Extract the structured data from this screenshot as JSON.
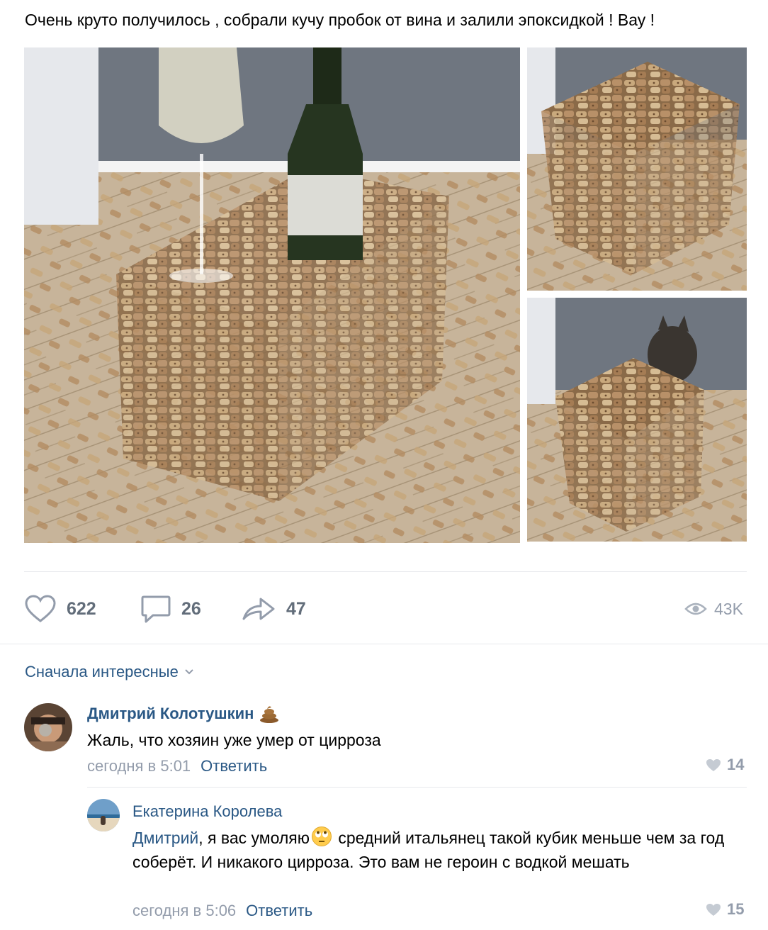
{
  "post": {
    "text": "Очень круто получилось , собрали кучу пробок от вина и залили эпоксидкой ! Вау !",
    "images": [
      {
        "description": "cork-cube-with-wine-bottle-and-glass"
      },
      {
        "description": "cork-cube-top-view"
      },
      {
        "description": "cork-cube-with-cat"
      }
    ]
  },
  "actions": {
    "likes": "622",
    "comments": "26",
    "shares": "47",
    "views": "43K"
  },
  "comments_sort": "Сначала интересные",
  "comments": [
    {
      "author": "Дмитрий Колотушкин",
      "author_emoji": "poop-emoji",
      "text": "Жаль, что хозяин уже умер от цирроза",
      "time": "сегодня в 5:01",
      "reply_label": "Ответить",
      "likes": "14"
    },
    {
      "author": "Екатерина Королева",
      "mention": "Дмитрий",
      "text_before_emoji": ", я вас умоляю",
      "inline_emoji": "rolling-eyes-emoji",
      "text_after_emoji": " средний итальянец такой кубик меньше чем за год соберёт. И никакого цирроза. Это вам не героин с водкой мешать",
      "time": "сегодня в 5:06",
      "reply_label": "Ответить",
      "likes": "15"
    }
  ],
  "colors": {
    "link": "#2a5885",
    "muted": "#939cab",
    "action": "#626d7a",
    "divider": "#e7e8ec"
  }
}
